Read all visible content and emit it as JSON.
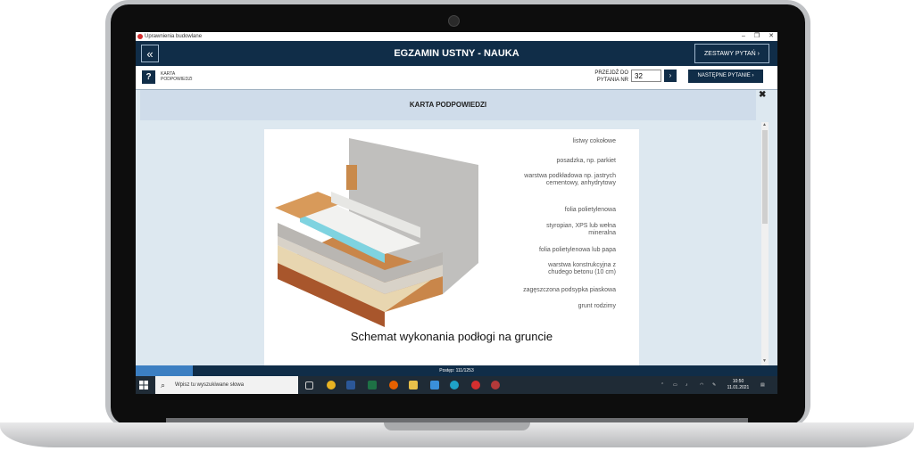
{
  "window": {
    "title": "Uprawnienia budowlane",
    "minimize": "–",
    "maximize": "❐",
    "close": "✕"
  },
  "header": {
    "back": "«",
    "title": "EGZAMIN USTNY - NAUKA",
    "sets_button": "ZESTAWY PYTAŃ  ›"
  },
  "toolbar": {
    "help": "?",
    "card_label": "KARTA PODPOWIEDZI",
    "goto_label": "PRZEJDŹ DO PYTANIA NR",
    "goto_value": "32",
    "goto_button": "›",
    "next_button": "NASTĘPNE PYTANIE  ›"
  },
  "card": {
    "title": "KARTA PODPOWIEDZI",
    "close": "✖",
    "caption": "Schemat wykonania podłogi na gruncie",
    "labels": [
      "listwy cokołowe",
      "posadzka, np. parkiet",
      "warstwa podkładowa np. jastrych cementowy, anhydrytowy",
      "folia polietylenowa",
      "styropian, XPS lub wełna mineralna",
      "folia polietylenowa lub papa",
      "warstwa konstrukcyjna z chudego betonu (10 cm)",
      "zagęszczona podsypka piaskowa",
      "grunt rodzimy"
    ]
  },
  "progress": {
    "text": "Postęp: 111/1253",
    "fraction": 0.0886
  },
  "taskbar": {
    "search_placeholder": "Wpisz tu wyszukiwane słowa",
    "time": "10:50",
    "date": "11.01.2021"
  }
}
